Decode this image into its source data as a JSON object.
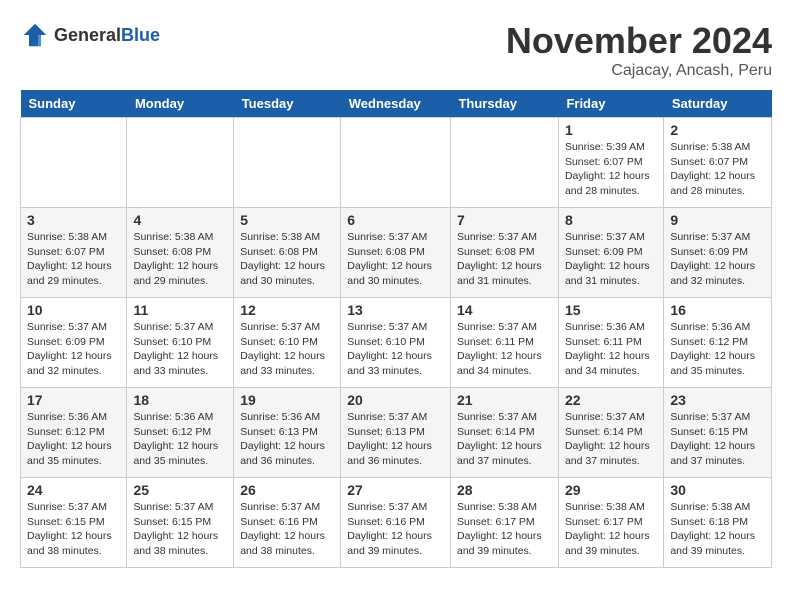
{
  "logo": {
    "general": "General",
    "blue": "Blue"
  },
  "title": "November 2024",
  "location": "Cajacay, Ancash, Peru",
  "weekdays": [
    "Sunday",
    "Monday",
    "Tuesday",
    "Wednesday",
    "Thursday",
    "Friday",
    "Saturday"
  ],
  "weeks": [
    [
      {
        "day": "",
        "info": ""
      },
      {
        "day": "",
        "info": ""
      },
      {
        "day": "",
        "info": ""
      },
      {
        "day": "",
        "info": ""
      },
      {
        "day": "",
        "info": ""
      },
      {
        "day": "1",
        "info": "Sunrise: 5:39 AM\nSunset: 6:07 PM\nDaylight: 12 hours and 28 minutes."
      },
      {
        "day": "2",
        "info": "Sunrise: 5:38 AM\nSunset: 6:07 PM\nDaylight: 12 hours and 28 minutes."
      }
    ],
    [
      {
        "day": "3",
        "info": "Sunrise: 5:38 AM\nSunset: 6:07 PM\nDaylight: 12 hours and 29 minutes."
      },
      {
        "day": "4",
        "info": "Sunrise: 5:38 AM\nSunset: 6:08 PM\nDaylight: 12 hours and 29 minutes."
      },
      {
        "day": "5",
        "info": "Sunrise: 5:38 AM\nSunset: 6:08 PM\nDaylight: 12 hours and 30 minutes."
      },
      {
        "day": "6",
        "info": "Sunrise: 5:37 AM\nSunset: 6:08 PM\nDaylight: 12 hours and 30 minutes."
      },
      {
        "day": "7",
        "info": "Sunrise: 5:37 AM\nSunset: 6:08 PM\nDaylight: 12 hours and 31 minutes."
      },
      {
        "day": "8",
        "info": "Sunrise: 5:37 AM\nSunset: 6:09 PM\nDaylight: 12 hours and 31 minutes."
      },
      {
        "day": "9",
        "info": "Sunrise: 5:37 AM\nSunset: 6:09 PM\nDaylight: 12 hours and 32 minutes."
      }
    ],
    [
      {
        "day": "10",
        "info": "Sunrise: 5:37 AM\nSunset: 6:09 PM\nDaylight: 12 hours and 32 minutes."
      },
      {
        "day": "11",
        "info": "Sunrise: 5:37 AM\nSunset: 6:10 PM\nDaylight: 12 hours and 33 minutes."
      },
      {
        "day": "12",
        "info": "Sunrise: 5:37 AM\nSunset: 6:10 PM\nDaylight: 12 hours and 33 minutes."
      },
      {
        "day": "13",
        "info": "Sunrise: 5:37 AM\nSunset: 6:10 PM\nDaylight: 12 hours and 33 minutes."
      },
      {
        "day": "14",
        "info": "Sunrise: 5:37 AM\nSunset: 6:11 PM\nDaylight: 12 hours and 34 minutes."
      },
      {
        "day": "15",
        "info": "Sunrise: 5:36 AM\nSunset: 6:11 PM\nDaylight: 12 hours and 34 minutes."
      },
      {
        "day": "16",
        "info": "Sunrise: 5:36 AM\nSunset: 6:12 PM\nDaylight: 12 hours and 35 minutes."
      }
    ],
    [
      {
        "day": "17",
        "info": "Sunrise: 5:36 AM\nSunset: 6:12 PM\nDaylight: 12 hours and 35 minutes."
      },
      {
        "day": "18",
        "info": "Sunrise: 5:36 AM\nSunset: 6:12 PM\nDaylight: 12 hours and 35 minutes."
      },
      {
        "day": "19",
        "info": "Sunrise: 5:36 AM\nSunset: 6:13 PM\nDaylight: 12 hours and 36 minutes."
      },
      {
        "day": "20",
        "info": "Sunrise: 5:37 AM\nSunset: 6:13 PM\nDaylight: 12 hours and 36 minutes."
      },
      {
        "day": "21",
        "info": "Sunrise: 5:37 AM\nSunset: 6:14 PM\nDaylight: 12 hours and 37 minutes."
      },
      {
        "day": "22",
        "info": "Sunrise: 5:37 AM\nSunset: 6:14 PM\nDaylight: 12 hours and 37 minutes."
      },
      {
        "day": "23",
        "info": "Sunrise: 5:37 AM\nSunset: 6:15 PM\nDaylight: 12 hours and 37 minutes."
      }
    ],
    [
      {
        "day": "24",
        "info": "Sunrise: 5:37 AM\nSunset: 6:15 PM\nDaylight: 12 hours and 38 minutes."
      },
      {
        "day": "25",
        "info": "Sunrise: 5:37 AM\nSunset: 6:15 PM\nDaylight: 12 hours and 38 minutes."
      },
      {
        "day": "26",
        "info": "Sunrise: 5:37 AM\nSunset: 6:16 PM\nDaylight: 12 hours and 38 minutes."
      },
      {
        "day": "27",
        "info": "Sunrise: 5:37 AM\nSunset: 6:16 PM\nDaylight: 12 hours and 39 minutes."
      },
      {
        "day": "28",
        "info": "Sunrise: 5:38 AM\nSunset: 6:17 PM\nDaylight: 12 hours and 39 minutes."
      },
      {
        "day": "29",
        "info": "Sunrise: 5:38 AM\nSunset: 6:17 PM\nDaylight: 12 hours and 39 minutes."
      },
      {
        "day": "30",
        "info": "Sunrise: 5:38 AM\nSunset: 6:18 PM\nDaylight: 12 hours and 39 minutes."
      }
    ]
  ]
}
